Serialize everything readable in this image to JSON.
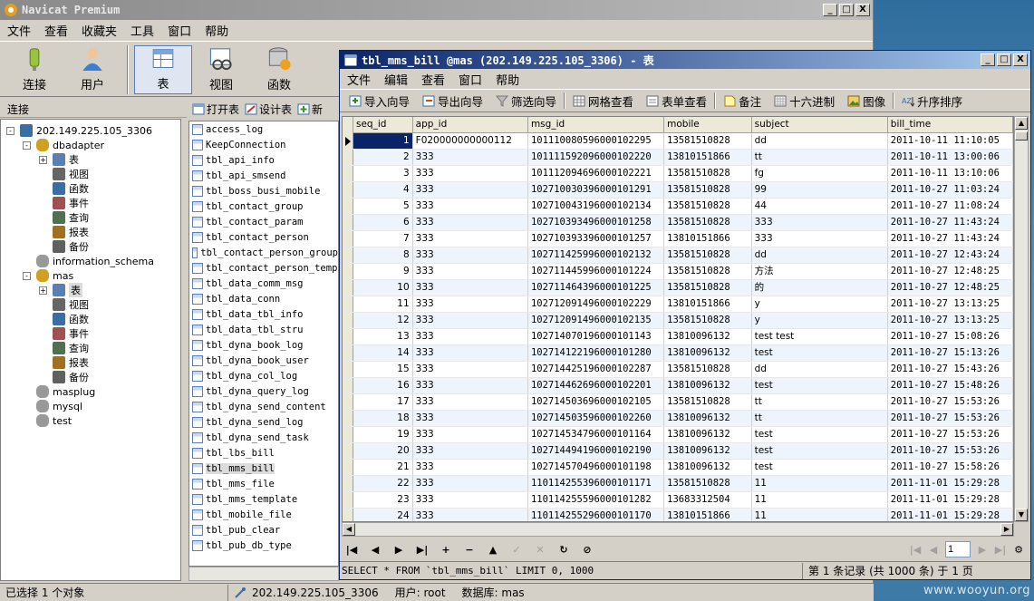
{
  "app": {
    "title": "Navicat Premium",
    "menu": [
      "文件",
      "查看",
      "收藏夹",
      "工具",
      "窗口",
      "帮助"
    ],
    "toolbar": [
      {
        "label": "连接",
        "icon": "connection-icon"
      },
      {
        "label": "用户",
        "icon": "user-icon"
      },
      {
        "label": "表",
        "icon": "table-icon",
        "active": true
      },
      {
        "label": "视图",
        "icon": "view-icon"
      },
      {
        "label": "函数",
        "icon": "function-icon"
      }
    ],
    "window_buttons": [
      "_",
      "□",
      "X"
    ]
  },
  "connections": {
    "header": "连接",
    "tree": [
      {
        "label": "202.149.225.105_3306",
        "level": 0,
        "icon": "connection-icon",
        "expander": "-"
      },
      {
        "label": "dbadapter",
        "level": 1,
        "icon": "database-open-icon",
        "expander": "-"
      },
      {
        "label": "表",
        "level": 2,
        "icon": "table-icon",
        "expander": "+"
      },
      {
        "label": "视图",
        "level": 2,
        "icon": "view-icon"
      },
      {
        "label": "函数",
        "level": 2,
        "icon": "function-icon"
      },
      {
        "label": "事件",
        "level": 2,
        "icon": "event-icon"
      },
      {
        "label": "查询",
        "level": 2,
        "icon": "query-icon"
      },
      {
        "label": "报表",
        "level": 2,
        "icon": "report-icon"
      },
      {
        "label": "备份",
        "level": 2,
        "icon": "backup-icon"
      },
      {
        "label": "information_schema",
        "level": 1,
        "icon": "database-icon"
      },
      {
        "label": "mas",
        "level": 1,
        "icon": "database-open-icon",
        "expander": "-"
      },
      {
        "label": "表",
        "level": 2,
        "icon": "table-icon",
        "expander": "+",
        "selected": true
      },
      {
        "label": "视图",
        "level": 2,
        "icon": "view-icon"
      },
      {
        "label": "函数",
        "level": 2,
        "icon": "function-icon"
      },
      {
        "label": "事件",
        "level": 2,
        "icon": "event-icon"
      },
      {
        "label": "查询",
        "level": 2,
        "icon": "query-icon"
      },
      {
        "label": "报表",
        "level": 2,
        "icon": "report-icon"
      },
      {
        "label": "备份",
        "level": 2,
        "icon": "backup-icon"
      },
      {
        "label": "masplug",
        "level": 1,
        "icon": "database-icon"
      },
      {
        "label": "mysql",
        "level": 1,
        "icon": "database-icon"
      },
      {
        "label": "test",
        "level": 1,
        "icon": "database-icon"
      }
    ]
  },
  "object_toolbar": {
    "open": "打开表",
    "design": "设计表",
    "new": "新"
  },
  "objects": [
    "access_log",
    "KeepConnection",
    "tbl_api_info",
    "tbl_api_smsend",
    "tbl_boss_busi_mobile",
    "tbl_contact_group",
    "tbl_contact_param",
    "tbl_contact_person",
    "tbl_contact_person_group",
    "tbl_contact_person_temp",
    "tbl_data_comm_msg",
    "tbl_data_conn",
    "tbl_data_tbl_info",
    "tbl_data_tbl_stru",
    "tbl_dyna_book_log",
    "tbl_dyna_book_user",
    "tbl_dyna_col_log",
    "tbl_dyna_query_log",
    "tbl_dyna_send_content",
    "tbl_dyna_send_log",
    "tbl_dyna_send_task",
    "tbl_lbs_bill",
    "tbl_mms_bill",
    "tbl_mms_file",
    "tbl_mms_template",
    "tbl_mobile_file",
    "tbl_pub_clear",
    "tbl_pub_db_type"
  ],
  "selected_object": "tbl_mms_bill",
  "status": {
    "selection": "已选择 1 个对象",
    "connection": "202.149.225.105_3306",
    "user": "用户: root",
    "database": "数据库: mas"
  },
  "table_window": {
    "title": "tbl_mms_bill @mas (202.149.225.105_3306) - 表",
    "menu": [
      "文件",
      "编辑",
      "查看",
      "窗口",
      "帮助"
    ],
    "toolbar": [
      {
        "label": "导入向导",
        "icon": "import-icon"
      },
      {
        "label": "导出向导",
        "icon": "export-icon"
      },
      {
        "label": "筛选向导",
        "icon": "filter-icon"
      },
      {
        "label": "网格查看",
        "icon": "grid-view-icon"
      },
      {
        "label": "表单查看",
        "icon": "form-view-icon"
      },
      {
        "label": "备注",
        "icon": "note-icon"
      },
      {
        "label": "十六进制",
        "icon": "hex-icon"
      },
      {
        "label": "图像",
        "icon": "image-icon"
      },
      {
        "label": "升序排序",
        "icon": "sort-asc-icon"
      }
    ],
    "columns": [
      "seq_id",
      "app_id",
      "msg_id",
      "mobile",
      "subject",
      "bill_time"
    ],
    "rows": [
      [
        "1",
        "F020000000000112",
        "101110080596000102295",
        "13581510828",
        "dd",
        "2011-10-11 11:10:05"
      ],
      [
        "2",
        "333",
        "101111592096000102220",
        "13810151866",
        "tt",
        "2011-10-11 13:00:06"
      ],
      [
        "3",
        "333",
        "101112094696000102221",
        "13581510828",
        "fg",
        "2011-10-11 13:10:06"
      ],
      [
        "4",
        "333",
        "102710030396000101291",
        "13581510828",
        "99",
        "2011-10-27 11:03:24"
      ],
      [
        "5",
        "333",
        "102710043196000102134",
        "13581510828",
        "44",
        "2011-10-27 11:08:24"
      ],
      [
        "6",
        "333",
        "102710393496000101258",
        "13581510828",
        "333",
        "2011-10-27 11:43:24"
      ],
      [
        "7",
        "333",
        "102710393396000101257",
        "13810151866",
        "333",
        "2011-10-27 11:43:24"
      ],
      [
        "8",
        "333",
        "102711425996000102132",
        "13581510828",
        "dd",
        "2011-10-27 12:43:24"
      ],
      [
        "9",
        "333",
        "102711445996000101224",
        "13581510828",
        "方法",
        "2011-10-27 12:48:25"
      ],
      [
        "10",
        "333",
        "102711464396000101225",
        "13581510828",
        "的",
        "2011-10-27 12:48:25"
      ],
      [
        "11",
        "333",
        "102712091496000102229",
        "13810151866",
        "y",
        "2011-10-27 13:13:25"
      ],
      [
        "12",
        "333",
        "102712091496000102135",
        "13581510828",
        "y",
        "2011-10-27 13:13:25"
      ],
      [
        "13",
        "333",
        "102714070196000101143",
        "13810096132",
        "test test",
        "2011-10-27 15:08:26"
      ],
      [
        "14",
        "333",
        "102714122196000101280",
        "13810096132",
        "test",
        "2011-10-27 15:13:26"
      ],
      [
        "15",
        "333",
        "102714425196000102287",
        "13581510828",
        "dd",
        "2011-10-27 15:43:26"
      ],
      [
        "16",
        "333",
        "102714462696000102201",
        "13810096132",
        "test",
        "2011-10-27 15:48:26"
      ],
      [
        "17",
        "333",
        "102714503696000102105",
        "13581510828",
        "tt",
        "2011-10-27 15:53:26"
      ],
      [
        "18",
        "333",
        "102714503596000102260",
        "13810096132",
        "tt",
        "2011-10-27 15:53:26"
      ],
      [
        "19",
        "333",
        "102714534796000101164",
        "13810096132",
        "test",
        "2011-10-27 15:53:26"
      ],
      [
        "20",
        "333",
        "102714494196000102190",
        "13810096132",
        "test",
        "2011-10-27 15:53:26"
      ],
      [
        "21",
        "333",
        "102714570496000101198",
        "13810096132",
        "test",
        "2011-10-27 15:58:26"
      ],
      [
        "22",
        "333",
        "110114255396000101171",
        "13581510828",
        "11",
        "2011-11-01 15:29:28"
      ],
      [
        "23",
        "333",
        "110114255596000101282",
        "13683312504",
        "11",
        "2011-11-01 15:29:28"
      ],
      [
        "24",
        "333",
        "110114255296000101170",
        "13810151866",
        "11",
        "2011-11-01 15:29:28"
      ]
    ],
    "nav": {
      "page": "1"
    },
    "sql": "SELECT * FROM `tbl_mms_bill` LIMIT 0, 1000",
    "record_info": "第 1 条记录 (共 1000 条) 于 1 页"
  },
  "watermark": "www.wooyun.org",
  "colors": {
    "title_active": "#0a246a",
    "title_inactive": "#8a8a8a",
    "selection": "#0a246a"
  }
}
